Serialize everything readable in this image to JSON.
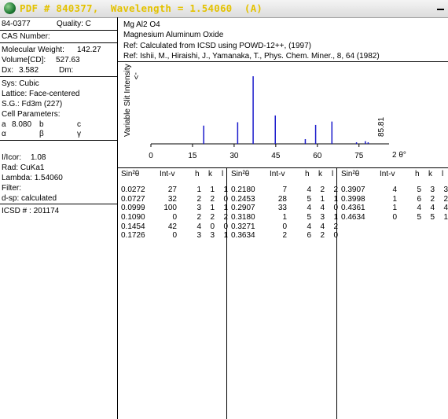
{
  "title": "PDF # 840377,  Wavelength = 1.54060  (A)",
  "left": {
    "pdf_number": "84-0377",
    "quality": "Quality: C",
    "cas": "CAS Number:",
    "mol_weight_label": "Molecular Weight:",
    "mol_weight": "142.27",
    "volume_label": "Volume[CD]:",
    "volume": "527.63",
    "dx_label": "Dx:",
    "dx": "3.582",
    "dm_label": "Dm:",
    "sys": "Sys: Cubic",
    "lattice": "Lattice: Face-centered",
    "sg": "S.G.: Fd3m (227)",
    "cell_params": "Cell Parameters:",
    "a_label": "a",
    "a_value": "8.080",
    "b_label": "b",
    "c_label": "c",
    "alpha": "α",
    "beta": "β",
    "gamma": "γ",
    "icor_label": "I/Icor:",
    "icor": "1.08",
    "rad": "Rad: CuKa1",
    "lambda": "Lambda: 1.54060",
    "filter": "Filter:",
    "dsp": "d-sp: calculated",
    "icsd": "ICSD # : 201174"
  },
  "ref": {
    "formula": "Mg Al2 O4",
    "name": "Magnesium Aluminum Oxide",
    "ref1": "Ref:  Calculated from ICSD using POWD-12++, (1997)",
    "ref2": "Ref: Ishii, M., Hiraishi, J., Yamanaka, T., Phys. Chem. Miner., 8, 64 (1982)"
  },
  "chart_data": {
    "type": "bar",
    "ylabel": "Variable Slit Intensity",
    "y_arrow": "->",
    "xlabel": "2 θ°",
    "x_ticks": [
      "0",
      "15",
      "30",
      "45",
      "60",
      "75"
    ],
    "xlim": [
      0,
      85.81
    ],
    "ylim": [
      0,
      100
    ],
    "max_label": "85.81",
    "peaks": [
      {
        "two_theta": 19.03,
        "intensity": 27
      },
      {
        "two_theta": 31.27,
        "intensity": 32
      },
      {
        "two_theta": 36.85,
        "intensity": 100
      },
      {
        "two_theta": 44.83,
        "intensity": 42
      },
      {
        "two_theta": 55.65,
        "intensity": 7
      },
      {
        "two_theta": 59.37,
        "intensity": 28
      },
      {
        "two_theta": 65.24,
        "intensity": 33
      },
      {
        "two_theta": 74.1,
        "intensity": 2
      },
      {
        "two_theta": 77.3,
        "intensity": 4
      },
      {
        "two_theta": 78.3,
        "intensity": 1
      }
    ]
  },
  "table": {
    "headers": [
      "Sin²θ",
      "Int-v",
      "h",
      "k",
      "l"
    ],
    "columns": [
      [
        [
          "0.0272",
          "27",
          "1",
          "1",
          "1"
        ],
        [
          "0.0727",
          "32",
          "2",
          "2",
          "0"
        ],
        [
          "0.0999",
          "100",
          "3",
          "1",
          "1"
        ],
        [
          "0.1090",
          "0",
          "2",
          "2",
          "2"
        ],
        [
          "0.1454",
          "42",
          "4",
          "0",
          "0"
        ],
        [
          "0.1726",
          "0",
          "3",
          "3",
          "1"
        ]
      ],
      [
        [
          "0.2180",
          "7",
          "4",
          "2",
          "2"
        ],
        [
          "0.2453",
          "28",
          "5",
          "1",
          "1"
        ],
        [
          "0.2907",
          "33",
          "4",
          "4",
          "0"
        ],
        [
          "0.3180",
          "1",
          "5",
          "3",
          "1"
        ],
        [
          "0.3271",
          "0",
          "4",
          "4",
          "2"
        ],
        [
          "0.3634",
          "2",
          "6",
          "2",
          "0"
        ]
      ],
      [
        [
          "0.3907",
          "4",
          "5",
          "3",
          "3"
        ],
        [
          "0.3998",
          "1",
          "6",
          "2",
          "2"
        ],
        [
          "0.4361",
          "1",
          "4",
          "4",
          "4"
        ],
        [
          "0.4634",
          "0",
          "5",
          "5",
          "1"
        ]
      ]
    ]
  }
}
